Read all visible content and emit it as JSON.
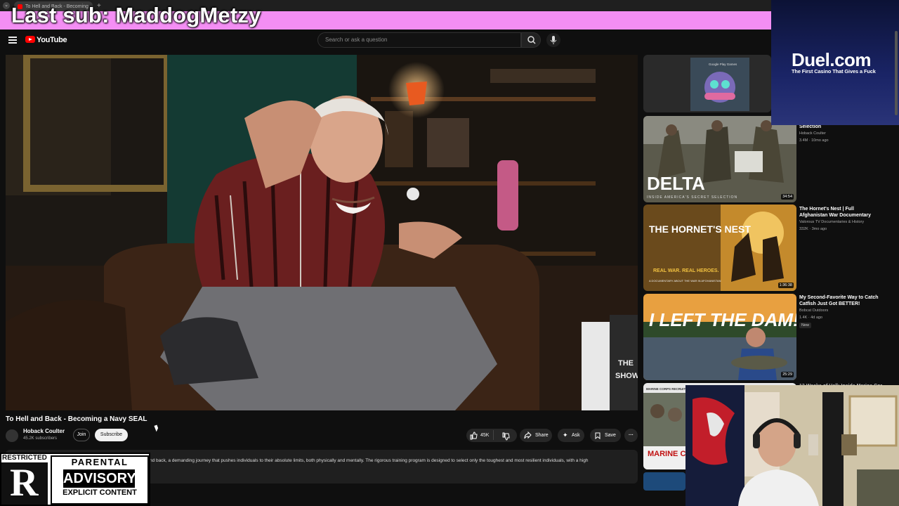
{
  "browser": {
    "tab_title": "To Hell and Back - Becoming",
    "new_tab_symbol": "+"
  },
  "overlay": {
    "last_sub": "Last sub: MaddogMetzy",
    "duel_logo": "Duel.com",
    "duel_tagline": "The First Casino That Gives a Fuck",
    "restricted_label": "RESTRICTED",
    "restricted_letter": "R",
    "parental_top": "PARENTAL",
    "parental_mid": "ADVISORY",
    "parental_bottom": "EXPLICIT CONTENT"
  },
  "header": {
    "logo_text": "YouTube",
    "search_placeholder": "Search or ask a question"
  },
  "video": {
    "title": "To Hell and Back - Becoming a Navy SEAL",
    "channel": "Hoback Coulter",
    "subscribers": "45.2K subscribers",
    "join_label": "Join",
    "subscribe_label": "Subscribe",
    "likes": "45K",
    "share_label": "Share",
    "ask_label": "Ask",
    "save_label": "Save",
    "description": "nd back, a demanding journey that pushes individuals to their absolute limits, both physically and mentally. The rigorous training program is designed to select only the toughest and most resilient individuals, with a high",
    "tv_text": "THE\nSHOW"
  },
  "sidebar": {
    "ad_label": "Google Play Games",
    "items": [
      {
        "title": "Selection",
        "channel": "Hoback Coulter",
        "meta": "3.4M · 10mo ago",
        "thumb_text": "DELTA",
        "thumb_sub": "INSIDE AMERICA'S SECRET SELECTION",
        "duration": "34:54"
      },
      {
        "title": "The Hornet's Nest | Full Afghanistan War Documentary",
        "channel": "Valorous TV Documentaries & History",
        "meta": "332K · 3mo ago",
        "thumb_text": "THE HORNET'S NEST",
        "thumb_sub": "REAL WAR. REAL HEROES.",
        "thumb_sub2": "A DOCUMENTARY ABOUT THE WAR IN AFGHANISTAN",
        "duration": "1:36:38"
      },
      {
        "title": "My Second-Favorite Way to Catch Catfish Just Got BETTER!",
        "channel": "Bobcat Outdoors",
        "meta": "1.4K · 4d ago",
        "badge": "New",
        "thumb_text": "I LEFT THE DAM!",
        "duration": "25:29"
      },
      {
        "title": "13 Weeks of Hell: Inside Marine Corps",
        "thumb_text": "MARINE CO BOOT C",
        "thumb_sub": "MARINE CORPS RECRUIT DEPOT"
      }
    ]
  }
}
